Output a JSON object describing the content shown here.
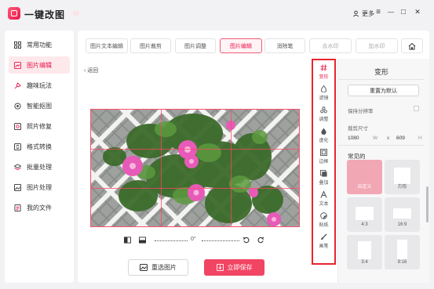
{
  "app": {
    "title": "一键改图",
    "more_label": "更多"
  },
  "window_controls": {
    "menu": "≡",
    "minimize": "—",
    "maximize": "□",
    "close": "✕"
  },
  "sidebar": {
    "items": [
      {
        "label": "常用功能",
        "icon": "grid-icon",
        "active": false
      },
      {
        "label": "图片编辑",
        "icon": "image-edit-icon",
        "active": true
      },
      {
        "label": "趣味玩法",
        "icon": "fun-icon",
        "active": false
      },
      {
        "label": "智能抠图",
        "icon": "cutout-icon",
        "active": false
      },
      {
        "label": "照片修复",
        "icon": "repair-icon",
        "active": false
      },
      {
        "label": "格式转换",
        "icon": "convert-icon",
        "active": false
      },
      {
        "label": "批量处理",
        "icon": "layers-icon",
        "active": false
      },
      {
        "label": "图片处理",
        "icon": "picture-icon",
        "active": false
      },
      {
        "label": "我的文件",
        "icon": "file-icon",
        "active": false
      }
    ]
  },
  "tabs": [
    {
      "label": "图片文本编辑",
      "active": false,
      "faint": false
    },
    {
      "label": "图片裁剪",
      "active": false,
      "faint": false
    },
    {
      "label": "图片调整",
      "active": false,
      "faint": false
    },
    {
      "label": "图片编辑",
      "active": true,
      "faint": false
    },
    {
      "label": "消除笔",
      "active": false,
      "faint": false
    },
    {
      "label": "去水印",
      "active": false,
      "faint": true
    },
    {
      "label": "加水印",
      "active": false,
      "faint": true
    }
  ],
  "back_label": "返回",
  "image_controls": {
    "rotation_value": "0°"
  },
  "buttons": {
    "reselect": "重选图片",
    "save": "立即保存"
  },
  "tools": [
    {
      "label": "变形",
      "icon": "hash-icon",
      "active": true
    },
    {
      "label": "滤镜",
      "icon": "drop-icon",
      "active": false
    },
    {
      "label": "调整",
      "icon": "adjust-icon",
      "active": false
    },
    {
      "label": "虚化",
      "icon": "blur-icon",
      "active": false
    },
    {
      "label": "边框",
      "icon": "frame-icon",
      "active": false
    },
    {
      "label": "叠加",
      "icon": "overlay-icon",
      "active": false
    },
    {
      "label": "文本",
      "icon": "text-icon",
      "active": false
    },
    {
      "label": "贴纸",
      "icon": "sticker-icon",
      "active": false
    },
    {
      "label": "画笔",
      "icon": "brush-icon",
      "active": false
    }
  ],
  "right_panel": {
    "title": "变形",
    "reset_label": "重置为默认",
    "keep_resolution_label": "保持分辨率",
    "crop_size_label": "裁剪尺寸",
    "width_value": "1080",
    "width_unit": "W",
    "separator": "x",
    "height_value": "609",
    "height_unit": "H",
    "common_label": "常见的",
    "presets": [
      {
        "label": "自定义",
        "active": true
      },
      {
        "label": "方形",
        "active": false
      },
      {
        "label": "4:3",
        "active": false
      },
      {
        "label": "16:9",
        "active": false
      },
      {
        "label": "3:4",
        "active": false
      },
      {
        "label": "9:16",
        "active": false
      }
    ]
  },
  "colors": {
    "accent": "#e8184a",
    "save_button": "#f14563",
    "highlight_box": "#e8252e"
  }
}
